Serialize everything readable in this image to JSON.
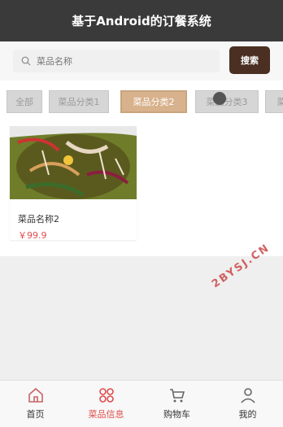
{
  "app": {
    "title": "基于Android的订餐系统"
  },
  "search": {
    "placeholder": "菜品名称",
    "button_label": "搜索"
  },
  "tabs": [
    {
      "label": "全部",
      "active": false
    },
    {
      "label": "菜品分类1",
      "active": false
    },
    {
      "label": "菜品分类2",
      "active": true
    },
    {
      "label": "菜品分类3",
      "active": false
    },
    {
      "label": "菜",
      "active": false
    }
  ],
  "items": [
    {
      "name": "菜品名称2",
      "price": "￥99.9"
    }
  ],
  "watermark": "2BYSJ.CN",
  "nav": [
    {
      "label": "首页",
      "icon": "home-icon",
      "active": false
    },
    {
      "label": "菜品信息",
      "icon": "menu-icon",
      "active": true
    },
    {
      "label": "购物车",
      "icon": "cart-icon",
      "active": false
    },
    {
      "label": "我的",
      "icon": "user-icon",
      "active": false
    }
  ],
  "colors": {
    "header": "#3a3a3a",
    "search_button": "#4a2f22",
    "active_tab": "#d8b28c",
    "price": "#e04c4c"
  }
}
